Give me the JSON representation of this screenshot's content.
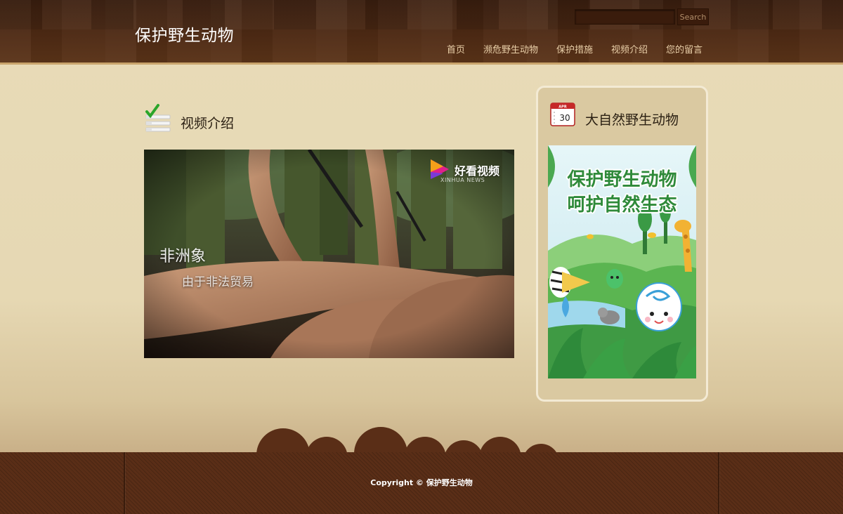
{
  "site": {
    "title": "保护野生动物"
  },
  "search": {
    "placeholder": "",
    "value": "",
    "button_label": "Search"
  },
  "nav": {
    "items": [
      {
        "label": "首页"
      },
      {
        "label": "濒危野生动物"
      },
      {
        "label": "保护措施"
      },
      {
        "label": "视频介绍"
      },
      {
        "label": "您的留言"
      }
    ]
  },
  "main": {
    "section_title": "视频介绍",
    "section_icon": "checklist-icon",
    "video": {
      "caption_title": "非洲象",
      "caption_sub": "由于非法贸易",
      "channel_name": "好看视频",
      "channel_sub": "XINHUA NEWS"
    }
  },
  "sidebar": {
    "title": "大自然野生动物",
    "icon": "calendar-icon",
    "calendar": {
      "month": "APR",
      "day": "30"
    },
    "poster": {
      "line1": "保护野生动物",
      "line2": "呵护自然生态"
    }
  },
  "footer": {
    "copyright": "Copyright © 保护野生动物"
  },
  "colors": {
    "header_bg": "#4e2a14",
    "page_bg": "#e8dbb8",
    "sidebar_bg": "#dac9a1",
    "nav_text": "#e9cfa8",
    "footer_bg": "#5a2e17",
    "poster_text": "#2f8a3a"
  }
}
